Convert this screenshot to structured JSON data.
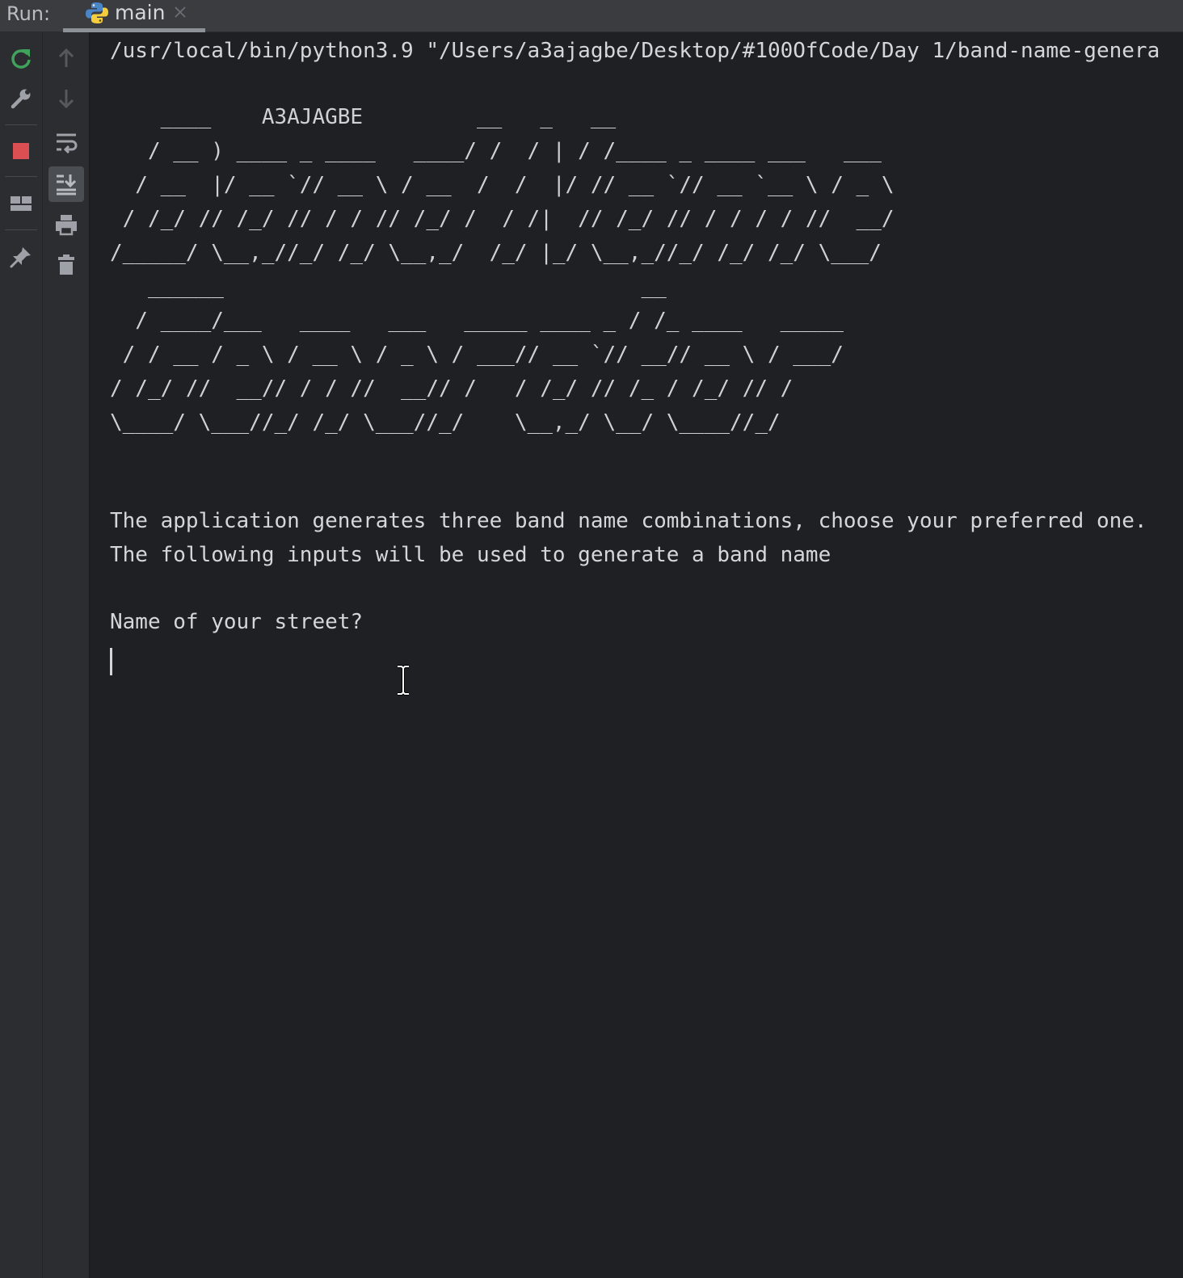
{
  "tabbar": {
    "run_label": "Run:",
    "tab_label": "main"
  },
  "toolbar": {
    "icons": [
      "rerun-icon",
      "settings-wrench-icon",
      "stop-icon",
      "layout-icon",
      "pin-icon",
      "up-arrow-icon",
      "down-arrow-icon",
      "soft-wrap-icon",
      "scroll-to-end-icon",
      "print-icon",
      "trash-icon"
    ]
  },
  "console": {
    "command": "/usr/local/bin/python3.9 \"/Users/a3ajagbe/Desktop/#100OfCode/Day 1/band-name-genera",
    "ascii_art": [
      "    ____    A3AJAGBE         __   _   __",
      "   / __ ) ____ _ ____   ____/ /  / | / /____ _ ____ ___   ___",
      "  / __  |/ __ `// __ \\ / __  /  /  |/ // __ `// __ `__ \\ / _ \\",
      " / /_/ // /_/ // / / // /_/ /  / /|  // /_/ // / / / / //  __/",
      "/_____/ \\__,_//_/ /_/ \\__,_/  /_/ |_/ \\__,_//_/ /_/ /_/ \\___/",
      "   ______                                 __",
      "  / ____/___   ____   ___   _____ ____ _ / /_ ____   _____",
      " / / __ / _ \\ / __ \\ / _ \\ / ___// __ `// __// __ \\ / ___/",
      "/ /_/ //  __// / / //  __// /   / /_/ // /_ / /_/ // /",
      "\\____/ \\___//_/ /_/ \\___//_/    \\__,_/ \\__/ \\____//_/"
    ],
    "intro_line_1": "The application generates three band name combinations, choose your preferred one.",
    "intro_line_2": "The following inputs will be used to generate a band name",
    "prompt": "Name of your street?"
  },
  "colors": {
    "console_bg": "#1f2023",
    "toolbar_bg": "#2b2d30",
    "text": "#d4d6da",
    "rerun_green": "#3fa35c",
    "stop_red": "#db4f52"
  }
}
